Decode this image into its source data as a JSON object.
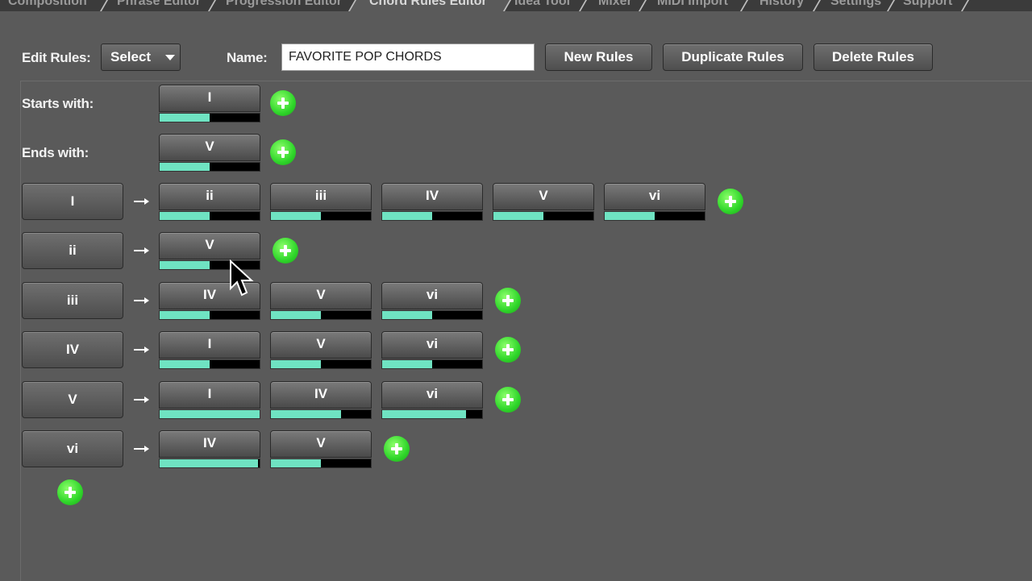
{
  "tabs": [
    {
      "label": "Composition",
      "active": false
    },
    {
      "label": "Phrase Editor",
      "active": false
    },
    {
      "label": "Progression Editor",
      "active": false
    },
    {
      "label": "Chord Rules Editor",
      "active": true
    },
    {
      "label": "Idea Tool",
      "active": false
    },
    {
      "label": "Mixer",
      "active": false
    },
    {
      "label": "MIDI Import",
      "active": false
    },
    {
      "label": "History",
      "active": false
    },
    {
      "label": "Settings",
      "active": false
    },
    {
      "label": "Support",
      "active": false
    }
  ],
  "toolbar": {
    "edit_rules_label": "Edit Rules:",
    "select_value": "Select",
    "name_label": "Name:",
    "name_value": "FAVORITE POP CHORDS",
    "new_rules": "New Rules",
    "duplicate_rules": "Duplicate Rules",
    "delete_rules": "Delete Rules"
  },
  "starts_with": {
    "label": "Starts with:",
    "chords": [
      {
        "name": "I",
        "weight": 0.5
      }
    ]
  },
  "ends_with": {
    "label": "Ends with:",
    "chords": [
      {
        "name": "V",
        "weight": 0.5
      }
    ]
  },
  "rules": [
    {
      "from": "I",
      "to": [
        {
          "name": "ii",
          "weight": 0.5
        },
        {
          "name": "iii",
          "weight": 0.5
        },
        {
          "name": "IV",
          "weight": 0.5
        },
        {
          "name": "V",
          "weight": 0.5
        },
        {
          "name": "vi",
          "weight": 0.5
        }
      ]
    },
    {
      "from": "ii",
      "to": [
        {
          "name": "V",
          "weight": 0.5
        }
      ]
    },
    {
      "from": "iii",
      "to": [
        {
          "name": "IV",
          "weight": 0.5
        },
        {
          "name": "V",
          "weight": 0.5
        },
        {
          "name": "vi",
          "weight": 0.5
        }
      ]
    },
    {
      "from": "IV",
      "to": [
        {
          "name": "I",
          "weight": 0.5
        },
        {
          "name": "V",
          "weight": 0.5
        },
        {
          "name": "vi",
          "weight": 0.5
        }
      ]
    },
    {
      "from": "V",
      "to": [
        {
          "name": "I",
          "weight": 1.0
        },
        {
          "name": "IV",
          "weight": 0.7
        },
        {
          "name": "vi",
          "weight": 0.84
        }
      ]
    },
    {
      "from": "vi",
      "to": [
        {
          "name": "IV",
          "weight": 0.98
        },
        {
          "name": "V",
          "weight": 0.5
        }
      ]
    }
  ],
  "icons": {
    "add": "plus-circle-icon",
    "arrow": "arrow-right-icon",
    "dropdown": "chevron-down-icon",
    "cursor": "mouse-pointer-icon"
  },
  "colors": {
    "background": "#5a5a5a",
    "weight_fill": "#6fe3c2",
    "weight_track": "#000000",
    "add_button": "#2fd62a"
  }
}
